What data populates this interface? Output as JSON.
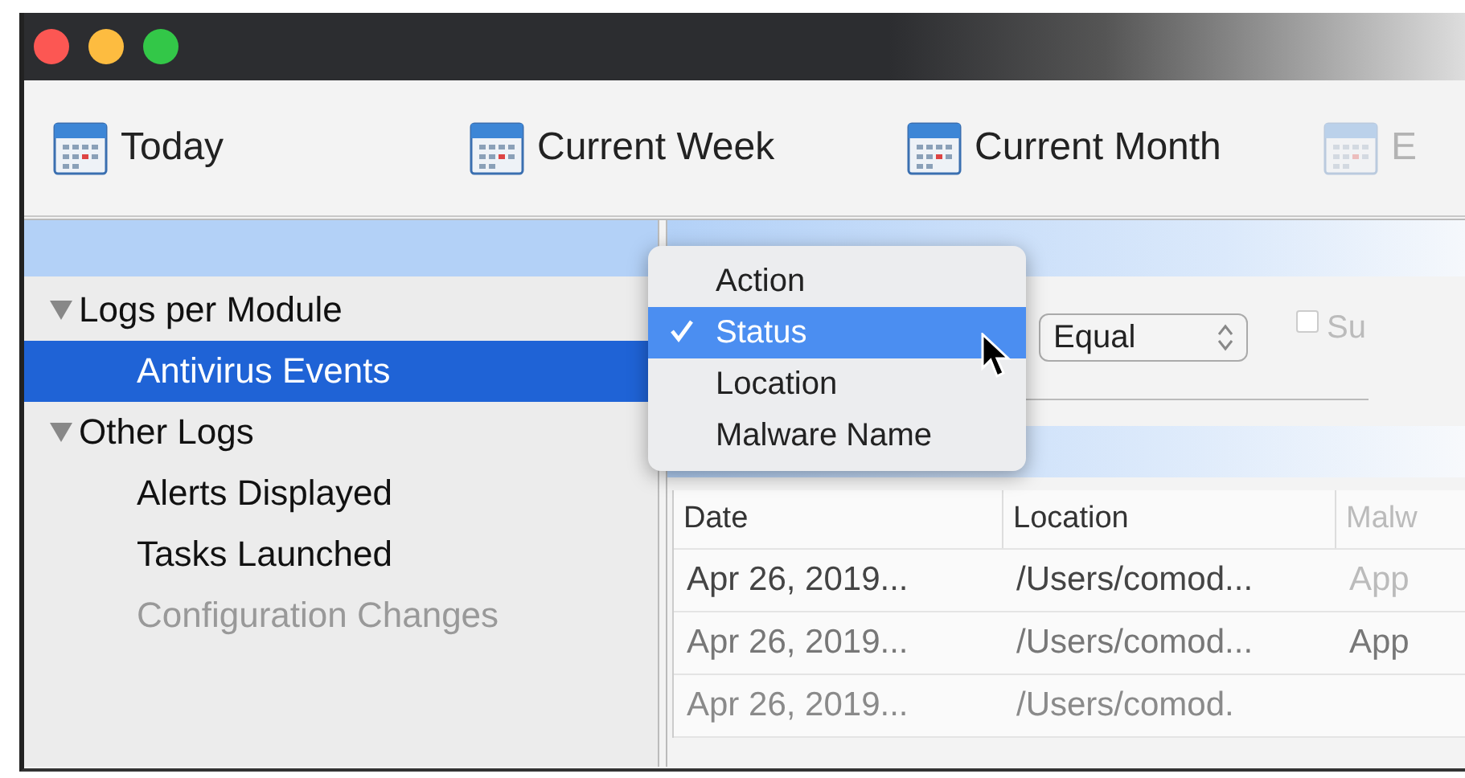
{
  "toolbar": {
    "items": [
      {
        "label": "Today"
      },
      {
        "label": "Current Week"
      },
      {
        "label": "Current Month"
      },
      {
        "label": "E"
      }
    ]
  },
  "sidebar": {
    "groups": [
      {
        "label": "Logs per Module",
        "expanded": true,
        "children": [
          {
            "label": "Antivirus Events",
            "selected": true,
            "disabled": false
          }
        ]
      },
      {
        "label": "Other Logs",
        "expanded": true,
        "children": [
          {
            "label": "Alerts Displayed",
            "selected": false,
            "disabled": false
          },
          {
            "label": "Tasks Launched",
            "selected": false,
            "disabled": false
          },
          {
            "label": "Configuration Changes",
            "selected": false,
            "disabled": true
          }
        ]
      }
    ]
  },
  "filter": {
    "field_menu": {
      "items": [
        {
          "label": "Action",
          "checked": false,
          "selected": false
        },
        {
          "label": "Status",
          "checked": true,
          "selected": true
        },
        {
          "label": "Location",
          "checked": false,
          "selected": false
        },
        {
          "label": "Malware Name",
          "checked": false,
          "selected": false
        }
      ]
    },
    "operator": "Equal",
    "checkbox": {
      "label": "Su",
      "checked": false
    }
  },
  "table": {
    "columns": [
      "Date",
      "Location",
      "Malw"
    ],
    "rows": [
      [
        "Apr 26, 2019...",
        "/Users/comod...",
        "App"
      ],
      [
        "Apr 26, 2019...",
        "/Users/comod...",
        "App"
      ],
      [
        "Apr 26, 2019...",
        "/Users/comod."
      ]
    ]
  }
}
